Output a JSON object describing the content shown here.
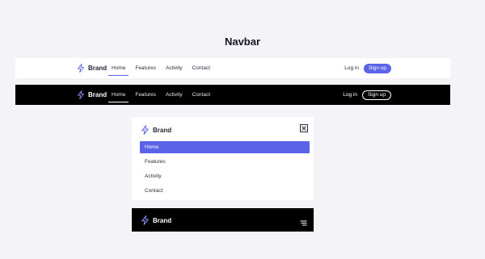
{
  "page": {
    "title": "Navbar"
  },
  "brand": {
    "name": "Brand",
    "icon": "bolt-icon",
    "accent": "#5b63e8"
  },
  "nav": {
    "links": [
      "Home",
      "Features",
      "Activity",
      "Contact"
    ],
    "active": "Home",
    "login": "Log in",
    "signup": "Sign up"
  },
  "mobile": {
    "items": [
      "Home",
      "Features",
      "Activity",
      "Contact"
    ],
    "close_icon": "close-icon",
    "menu_icon": "menu-icon"
  },
  "colors": {
    "accent": "#5b63e8",
    "dark_bg": "#000000",
    "light_bg": "#ffffff",
    "page_bg": "#f3f3f8"
  }
}
